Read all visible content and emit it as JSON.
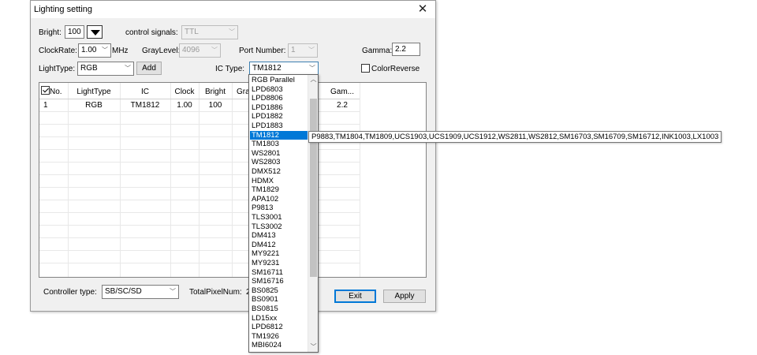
{
  "window": {
    "title": "Lighting setting",
    "close_glyph": "✕"
  },
  "bright": {
    "label": "Bright:",
    "value": "100"
  },
  "control_signals": {
    "label": "control signals:",
    "value": "TTL"
  },
  "clockrate": {
    "label": "ClockRate:",
    "value": "1.00",
    "unit": "MHz"
  },
  "graylevel": {
    "label": "GrayLevel:",
    "value": "4096"
  },
  "port_number": {
    "label": "Port Number:",
    "value": "1"
  },
  "gamma": {
    "label": "Gamma:",
    "value": "2.2"
  },
  "lighttype": {
    "label": "LightType:",
    "value": "RGB",
    "add_label": "Add"
  },
  "ic_type": {
    "label": "IC Type:",
    "value": "TM1812"
  },
  "color_reverse": {
    "label": "ColorReverse",
    "checked": false
  },
  "table": {
    "headers": [
      "No.",
      "LightType",
      "IC",
      "Clock",
      "Bright",
      "Gray",
      "Gam..."
    ],
    "rows": [
      {
        "no": "1",
        "lighttype": "RGB",
        "ic": "TM1812",
        "clock": "1.00",
        "bright": "100",
        "gamma": "2.2"
      }
    ]
  },
  "dropdown": {
    "items": [
      "RGB Parallel",
      "LPD6803",
      "LPD8806",
      "LPD1886",
      "LPD1882",
      "LPD1883",
      "TM1812",
      "TM1803",
      "WS2801",
      "WS2803",
      "DMX512",
      "HDMX",
      "TM1829",
      "APA102",
      "P9813",
      "TLS3001",
      "TLS3002",
      "DM413",
      "DM412",
      "MY9221",
      "MY9231",
      "SM16711",
      "SM16716",
      "BS0825",
      "BS0901",
      "BS0815",
      "LD15xx",
      "LPD6812",
      "TM1926",
      "MBI6024"
    ],
    "selected_index": 6
  },
  "tooltip": "P9883,TM1804,TM1809,UCS1903,UCS1909,UCS1912,WS2811,WS2812,SM16703,SM16709,SM16712,INK1003,LX1003",
  "footer": {
    "controller_type_label": "Controller type:",
    "controller_type_value": "SB/SC/SD",
    "total_pixel_label": "TotalPixelNum:",
    "total_pixel_value": "2",
    "exit_label": "Exit",
    "apply_label": "Apply"
  }
}
